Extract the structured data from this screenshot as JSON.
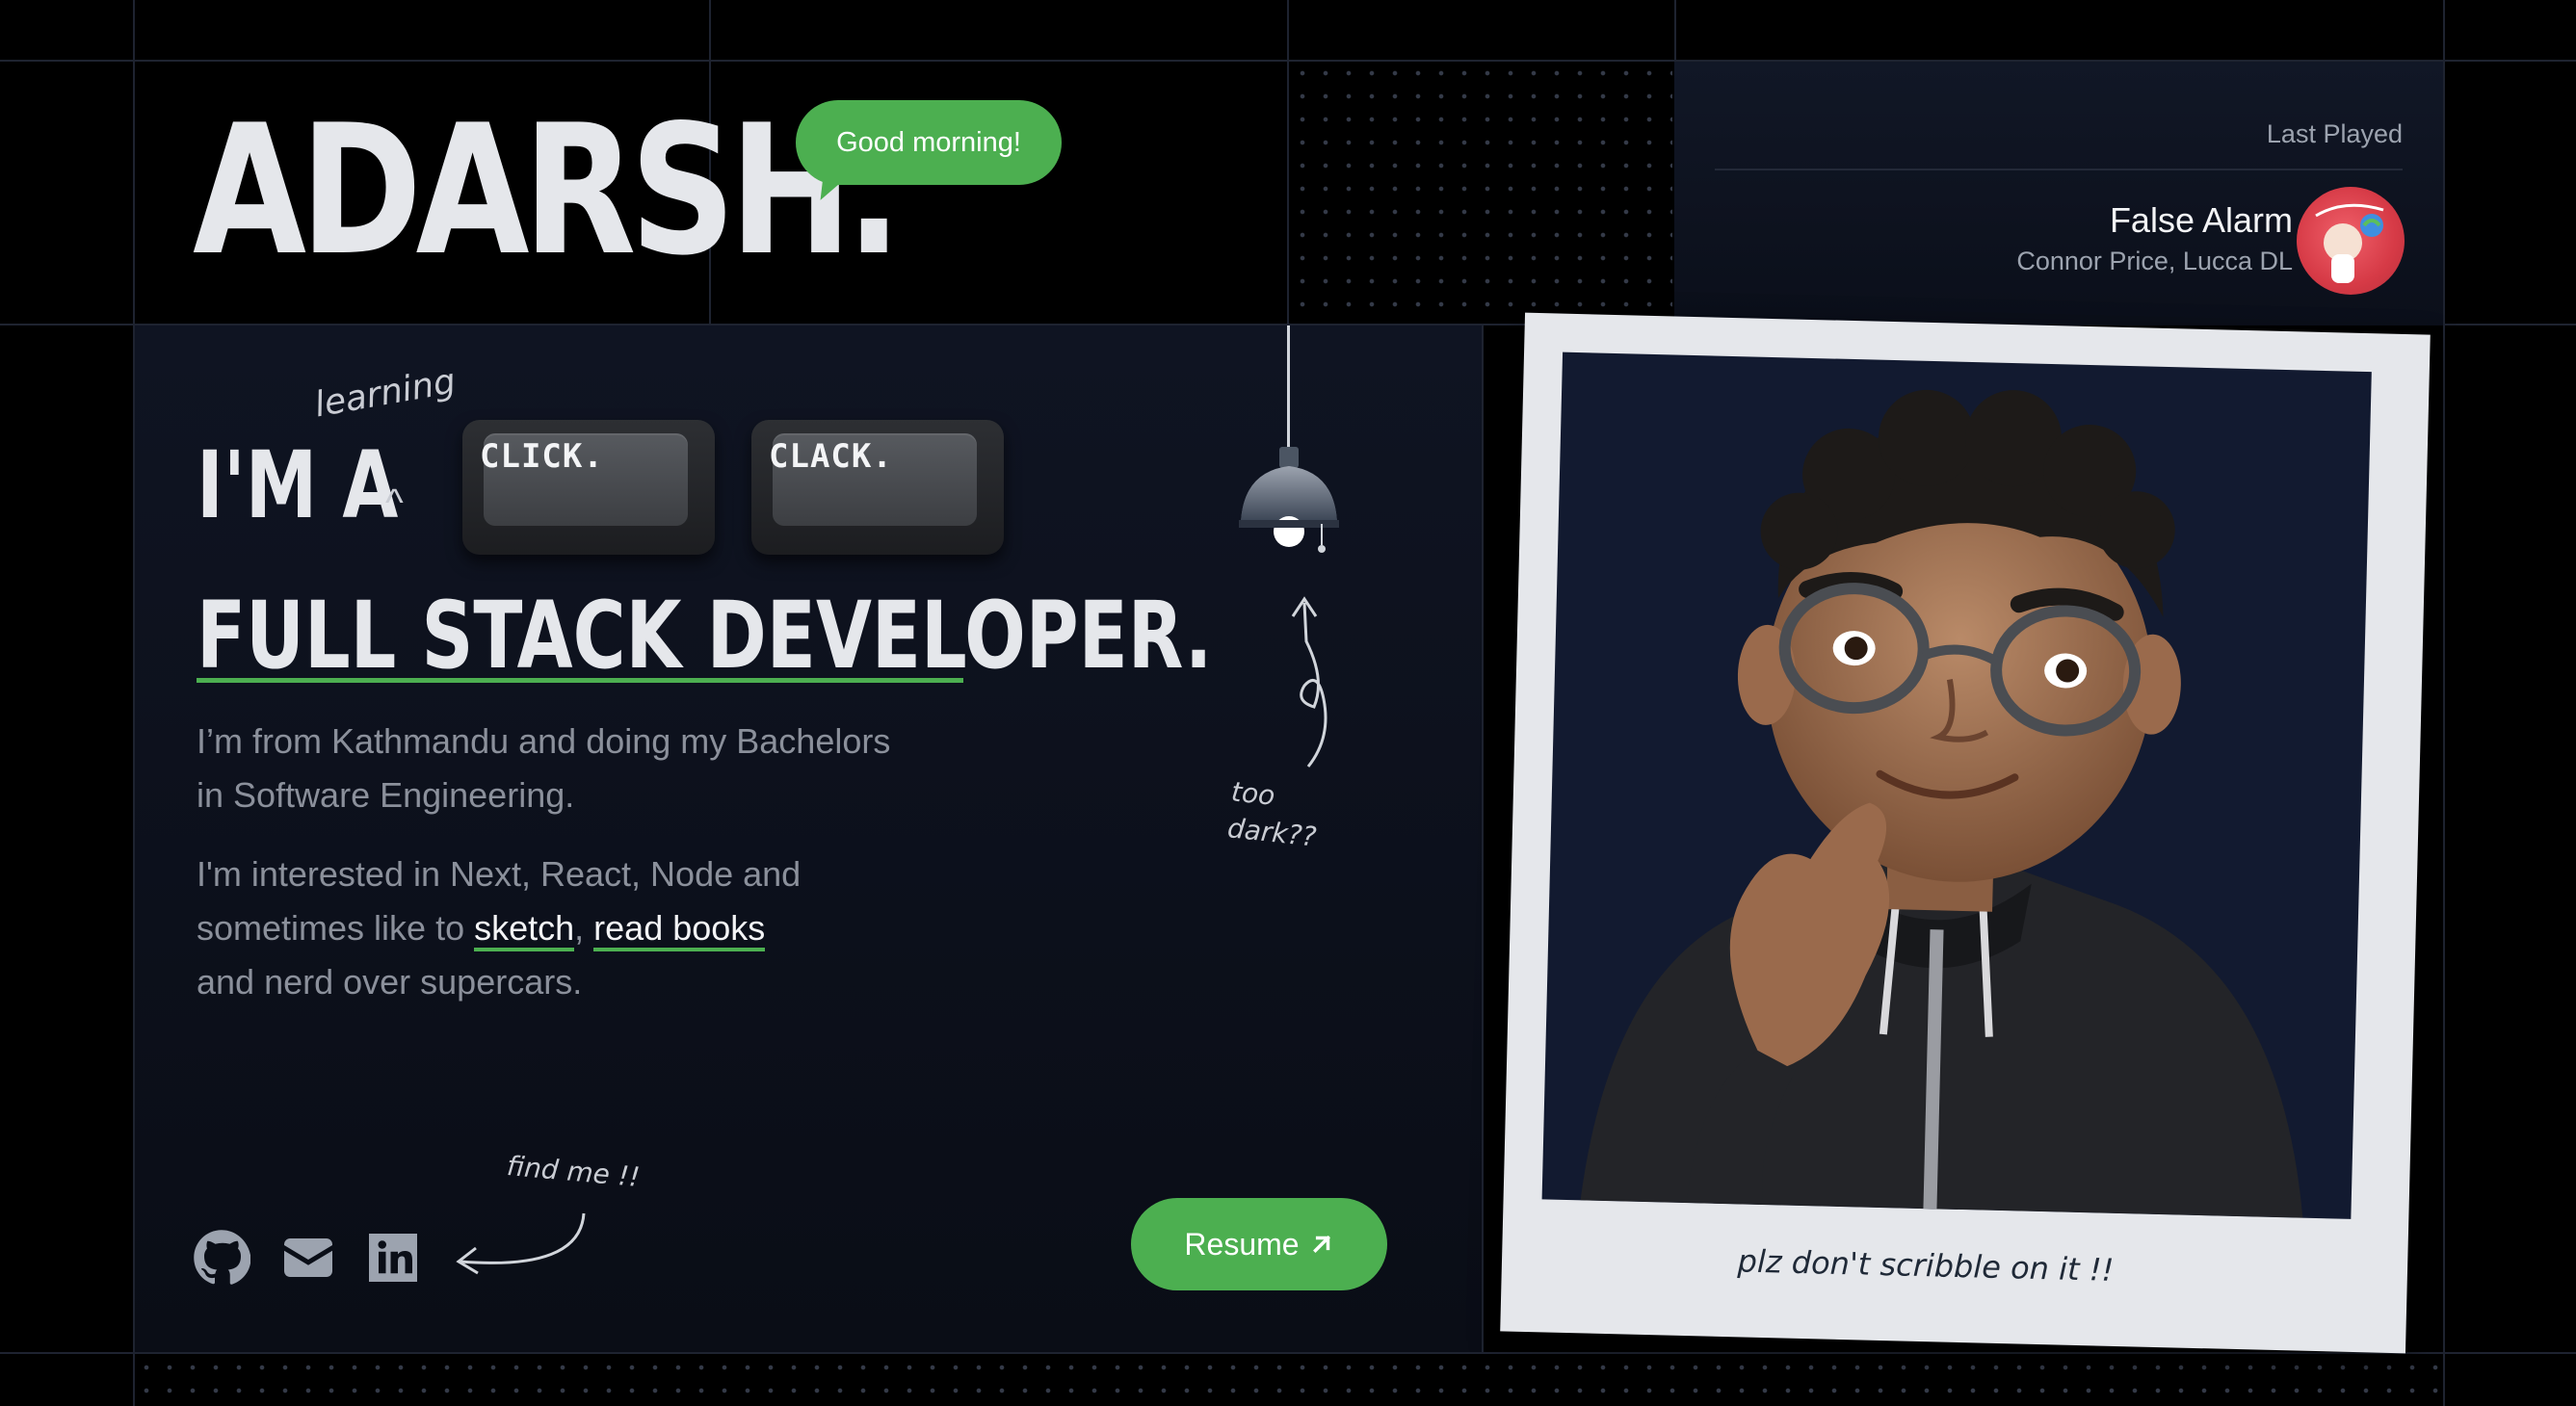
{
  "header": {
    "logo": "ADARSH.",
    "greeting": "Good morning!"
  },
  "music": {
    "label": "Last Played",
    "title": "False Alarm",
    "artist": "Connor Price, Lucca DL",
    "album_art_icon": "album-cover"
  },
  "hero": {
    "prefix": "I'M A",
    "annotation": "learning",
    "keys": [
      "CLICK.",
      "CLACK."
    ],
    "role": "FULL STACK DEVELOPER.",
    "bio_line1": "I’m from Kathmandu and doing my Bachelors",
    "bio_line2": "in Software Engineering.",
    "interests_line1": "I'm interested in Next, React, Node and",
    "interests_prefix": "sometimes like to ",
    "interests_link1": "sketch",
    "interests_sep": ", ",
    "interests_link2": "read books",
    "interests_line3": "and nerd over supercars."
  },
  "lamp": {
    "note_line1": "too",
    "note_line2": "dark??"
  },
  "socials": {
    "note": "find me !!",
    "icons": [
      "github-icon",
      "mail-icon",
      "linkedin-icon"
    ]
  },
  "resume": {
    "label": "Resume"
  },
  "polaroid": {
    "caption": "plz don't scribble on it !!"
  },
  "colors": {
    "accent": "#4caf50",
    "background": "#000000",
    "panel": "#0f1422",
    "text": "#e5e7eb",
    "muted": "#8b909b"
  }
}
